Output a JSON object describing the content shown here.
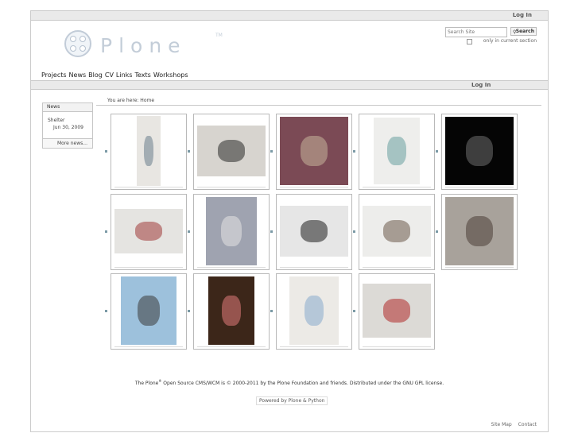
{
  "topbar": {
    "login": "Log In"
  },
  "logo": {
    "word": "Plone",
    "tm": "TM"
  },
  "search": {
    "placeholder": "Search Site",
    "button": "Search",
    "scope_label": "only in current section"
  },
  "nav": {
    "items": [
      "Projects",
      "News",
      "Blog",
      "CV",
      "Links",
      "Texts",
      "Workshops"
    ]
  },
  "personalbar": {
    "login": "Log In"
  },
  "news_portlet": {
    "header": "News",
    "item_title": "Shelter",
    "item_date": "Jun 30, 2009",
    "more": "More news..."
  },
  "breadcrumbs": "You are here: Home",
  "gallery": {
    "images": [
      {
        "name": "plant-on-paper",
        "bg": "#e8e6e2",
        "fg": "#6a7d8c"
      },
      {
        "name": "white-cloth-table",
        "bg": "#d7d4cf",
        "fg": "#2a2a2a"
      },
      {
        "name": "hand-holding-object",
        "bg": "#7b4a55",
        "fg": "#c7b59a"
      },
      {
        "name": "printed-page",
        "bg": "#eeeeec",
        "fg": "#6aa0a0"
      },
      {
        "name": "dark-folded-book",
        "bg": "#050505",
        "fg": "#6d6d6d"
      },
      {
        "name": "red-pattern-box",
        "bg": "#e5e4e1",
        "fg": "#a13a3a"
      },
      {
        "name": "line-drawing-gray",
        "bg": "#9fa3b0",
        "fg": "#e4e4e4"
      },
      {
        "name": "dotted-figure",
        "bg": "#e6e6e6",
        "fg": "#1d1d1d"
      },
      {
        "name": "lace-sketch",
        "bg": "#ededeb",
        "fg": "#6b5a4a"
      },
      {
        "name": "chair-sketch",
        "bg": "#a8a29b",
        "fg": "#4a3e36"
      },
      {
        "name": "blue-painting",
        "bg": "#9dc1dc",
        "fg": "#3b3b3b"
      },
      {
        "name": "wooden-box",
        "bg": "#3c2619",
        "fg": "#e07a7a"
      },
      {
        "name": "figure-collage",
        "bg": "#eceae6",
        "fg": "#88aacc"
      },
      {
        "name": "red-books",
        "bg": "#dcdad6",
        "fg": "#b12a2a"
      }
    ]
  },
  "footer": {
    "pre": "The Plone",
    "reg": "®",
    "post": " Open Source CMS/WCM is © 2000-2011 by the Plone Foundation and friends. Distributed under the GNU GPL license.",
    "powered": "Powered by Plone & Python"
  },
  "site_actions": [
    "Site Map",
    "Contact"
  ]
}
